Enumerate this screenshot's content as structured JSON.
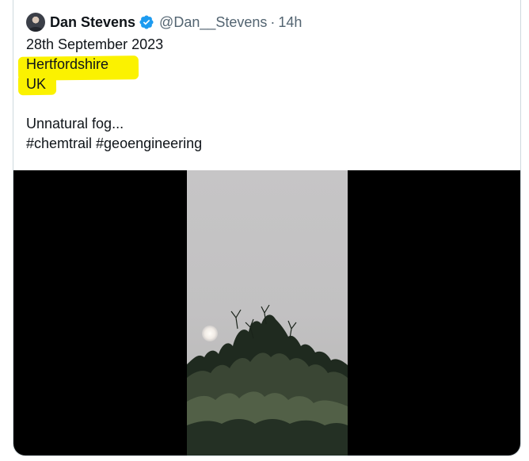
{
  "tweet": {
    "author_name": "Dan Stevens",
    "handle": "@Dan__Stevens",
    "separator": "·",
    "time": "14h",
    "lines": {
      "date": "28th September 2023",
      "county": "Hertfordshire",
      "country": "UK",
      "text": "Unnatural fog...",
      "hashtags": "#chemtrail #geoengineering"
    },
    "icons": {
      "avatar": "profile-avatar",
      "verified": "verified-badge-icon"
    },
    "colors": {
      "verified_blue": "#1d9bf0",
      "highlight_yellow": "#fbf200",
      "text_primary": "#0f1419",
      "text_secondary": "#536471",
      "border": "#cfd9de"
    },
    "media": {
      "type": "video",
      "description_icon": "video-thumbnail"
    }
  }
}
